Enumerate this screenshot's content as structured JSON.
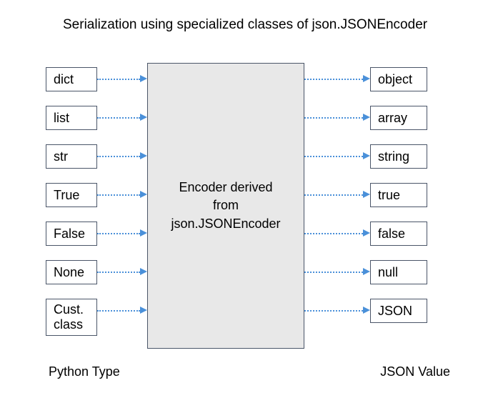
{
  "title": "Serialization using specialized classes of json.JSONEncoder",
  "python_types": {
    "t0": "dict",
    "t1": "list",
    "t2": "str",
    "t3": "True",
    "t4": "False",
    "t5": "None",
    "t6_line1": "Cust.",
    "t6_line2": "class"
  },
  "encoder": {
    "line1": "Encoder derived",
    "line2": "from",
    "line3": "json.JSONEncoder"
  },
  "json_values": {
    "v0": "object",
    "v1": "array",
    "v2": "string",
    "v3": "true",
    "v4": "false",
    "v5": "null",
    "v6": "JSON"
  },
  "labels": {
    "left": "Python Type",
    "right": "JSON Value"
  }
}
